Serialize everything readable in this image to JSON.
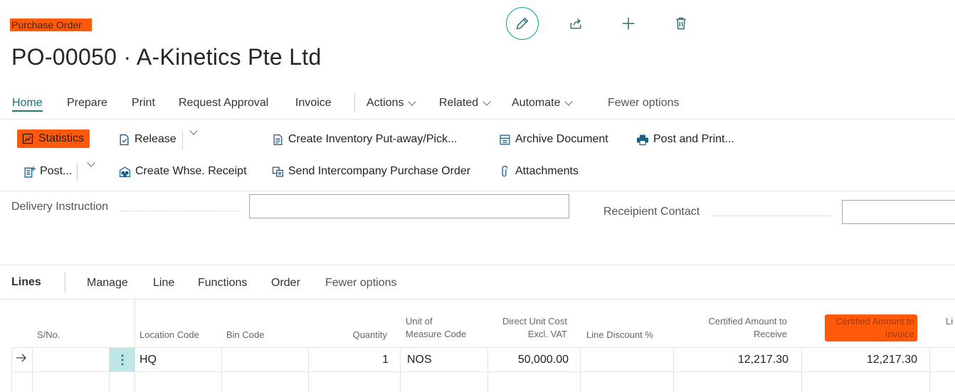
{
  "page": {
    "caption": "Purchase Order",
    "title": "PO-00050 · A-Kinetics Pte Ltd"
  },
  "toolbar": {
    "edit": "pencil-icon",
    "share": "share-icon",
    "new": "plus-icon",
    "delete": "trash-icon"
  },
  "menu": {
    "home": "Home",
    "prepare": "Prepare",
    "print": "Print",
    "request_approval": "Request Approval",
    "invoice": "Invoice",
    "actions": "Actions",
    "related": "Related",
    "automate": "Automate",
    "fewer_options": "Fewer options"
  },
  "actions": {
    "statistics": "Statistics",
    "release": "Release",
    "create_inventory": "Create Inventory Put-away/Pick...",
    "archive_document": "Archive Document",
    "post_and_print": "Post and Print...",
    "post": "Post...",
    "create_whse_receipt": "Create Whse. Receipt",
    "send_intercompany": "Send Intercompany Purchase Order",
    "attachments": "Attachments"
  },
  "fields": {
    "delivery_instruction": {
      "label": "Delivery Instruction",
      "value": ""
    },
    "recipient_contact": {
      "label": "Receipient Contact",
      "value": ""
    }
  },
  "lines": {
    "title": "Lines",
    "menu": {
      "manage": "Manage",
      "line": "Line",
      "functions": "Functions",
      "order": "Order",
      "fewer_options": "Fewer options"
    },
    "columns": {
      "sno": "S/No.",
      "location_code": "Location Code",
      "bin_code": "Bin Code",
      "quantity": "Quantity",
      "uom_line1": "Unit of",
      "uom_line2": "Measure Code",
      "duc_line1": "Direct Unit Cost",
      "duc_line2": "Excl. VAT",
      "line_discount": "Line Discount %",
      "car_line1": "Certified Amount to",
      "car_line2": "Receive",
      "cai_line1": "Certified Amount to",
      "cai_line2": "Invoice",
      "next_col": "Li"
    },
    "rows": [
      {
        "sno": "",
        "location_code": "HQ",
        "bin_code": "",
        "quantity": "1",
        "uom": "NOS",
        "direct_unit_cost": "50,000.00",
        "line_discount": "",
        "certified_receive": "12,217.30",
        "certified_invoice": "12,217.30"
      }
    ]
  }
}
